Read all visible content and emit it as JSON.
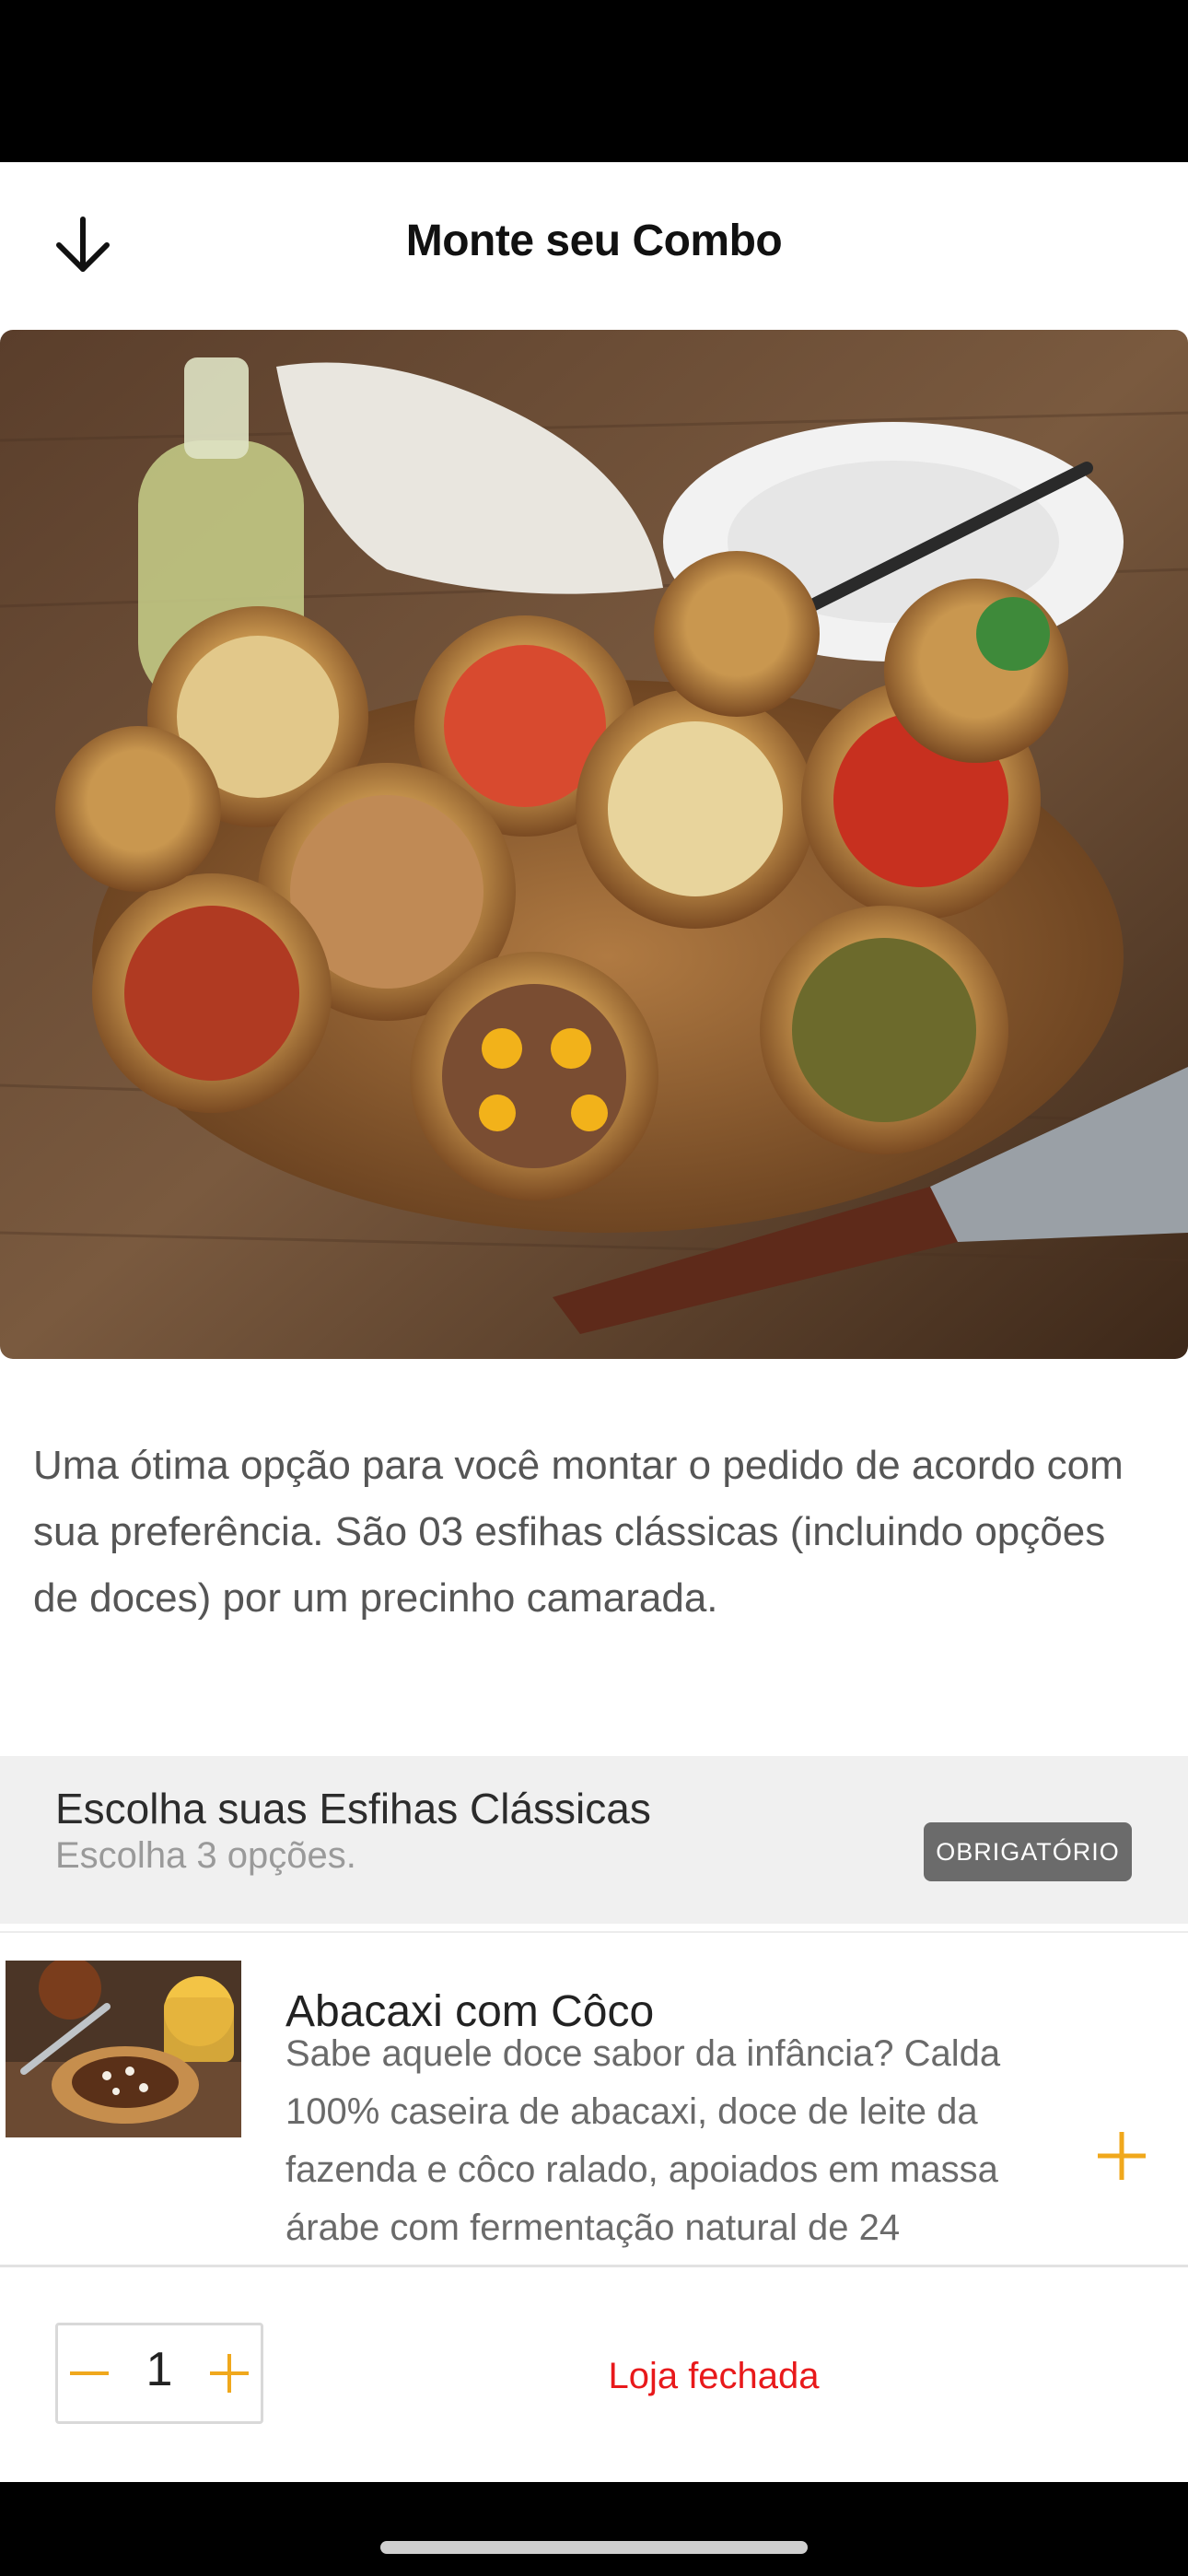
{
  "header": {
    "title": "Monte seu Combo",
    "back_icon": "arrow-down-icon"
  },
  "product": {
    "image": "esfiha-combo-photo",
    "description": "Uma ótima opção para você montar o pedido de acordo com sua preferência. São 03 esfihas clássicas (incluindo opções de doces) por um precinho camarada."
  },
  "option_group": {
    "title": "Escolha suas Esfihas Clássicas",
    "subtitle": "Escolha 3 opções.",
    "badge": "OBRIGATÓRIO",
    "items": [
      {
        "name": "Abacaxi com Côco",
        "description": "Sabe aquele doce sabor da infância? Calda 100% caseira de abacaxi, doce de leite da fazenda e côco ralado, apoiados em massa árabe com fermentação natural de 24",
        "add_icon": "plus-icon"
      }
    ]
  },
  "footer": {
    "quantity": "1",
    "minus_icon": "minus-icon",
    "plus_icon": "plus-icon",
    "status": "Loja fechada"
  },
  "colors": {
    "accent": "#F0A81C",
    "status_closed": "#E8191B",
    "section_bg": "#F0F0F0",
    "badge_bg": "#6B6B6B"
  }
}
